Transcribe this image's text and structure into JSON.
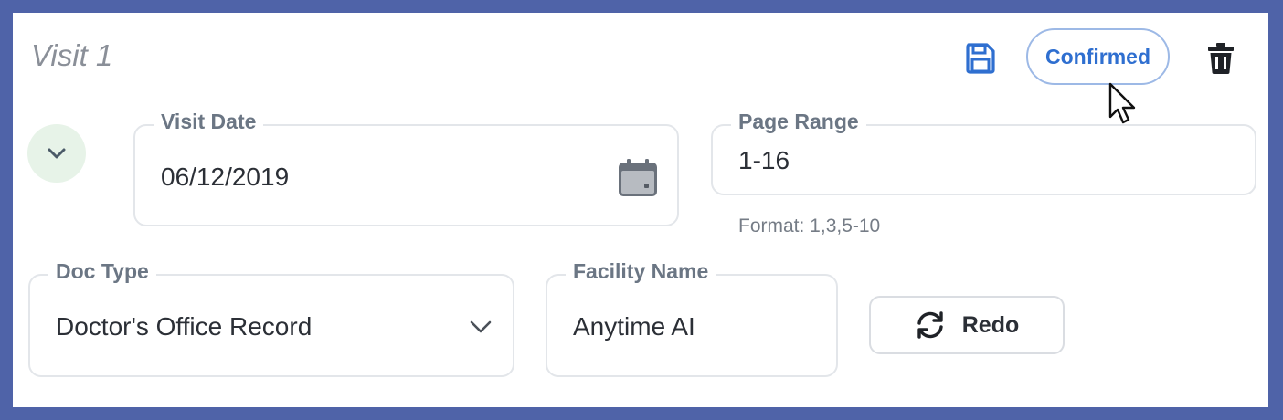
{
  "visit": {
    "title": "Visit 1",
    "status_label": "Confirmed"
  },
  "fields": {
    "visit_date": {
      "label": "Visit Date",
      "value": "06/12/2019"
    },
    "page_range": {
      "label": "Page Range",
      "value": "1-16",
      "helper": "Format: 1,3,5-10"
    },
    "doc_type": {
      "label": "Doc Type",
      "value": "Doctor's Office Record"
    },
    "facility_name": {
      "label": "Facility Name",
      "value": "Anytime AI"
    }
  },
  "actions": {
    "redo_label": "Redo"
  },
  "icons": {
    "save": "floppy-disk-icon",
    "delete": "trash-icon",
    "collapse": "chevron-down-icon",
    "calendar": "calendar-icon",
    "select": "chevron-down-icon",
    "redo": "refresh-icon"
  },
  "colors": {
    "frame": "#4f63a8",
    "accent": "#2f6fd0",
    "collapse_bg": "#e7f3e8"
  }
}
